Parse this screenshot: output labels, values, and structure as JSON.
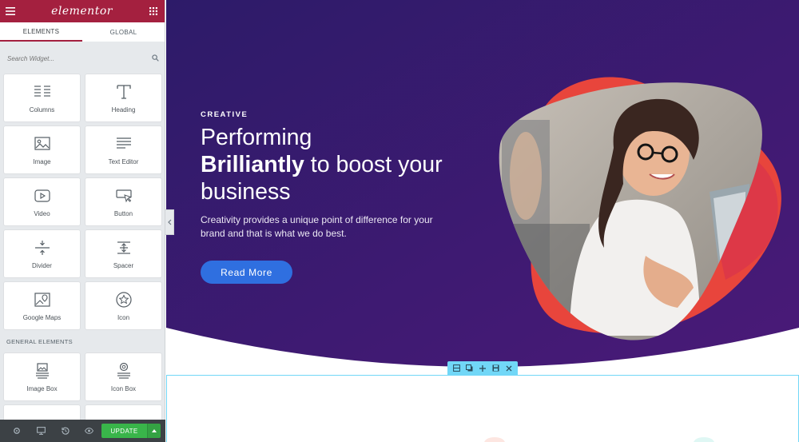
{
  "sidebar": {
    "logo": "elementor",
    "tabs": [
      {
        "label": "ELEMENTS",
        "active": true
      },
      {
        "label": "GLOBAL",
        "active": false
      }
    ],
    "search_placeholder": "Search Widget...",
    "widgets": [
      {
        "label": "Columns",
        "icon": "columns-icon"
      },
      {
        "label": "Heading",
        "icon": "heading-icon"
      },
      {
        "label": "Image",
        "icon": "image-icon"
      },
      {
        "label": "Text Editor",
        "icon": "text-editor-icon"
      },
      {
        "label": "Video",
        "icon": "video-icon"
      },
      {
        "label": "Button",
        "icon": "button-icon"
      },
      {
        "label": "Divider",
        "icon": "divider-icon"
      },
      {
        "label": "Spacer",
        "icon": "spacer-icon"
      },
      {
        "label": "Google Maps",
        "icon": "google-maps-icon"
      },
      {
        "label": "Icon",
        "icon": "star-icon"
      }
    ],
    "general_section_title": "GENERAL ELEMENTS",
    "general_widgets": [
      {
        "label": "Image Box",
        "icon": "image-box-icon"
      },
      {
        "label": "Icon Box",
        "icon": "icon-box-icon"
      }
    ],
    "footer": {
      "update_label": "UPDATE"
    }
  },
  "hero": {
    "eyebrow": "CREATIVE",
    "headline_line1": "Performing",
    "headline_bold": "Brilliantly",
    "headline_rest": " to boost your",
    "headline_line3": "business",
    "description": "Creativity provides a unique point of difference for your brand and that is what we do best.",
    "cta_label": "Read More"
  },
  "colors": {
    "brand": "#a4203f",
    "hero_gradient_start": "#2d1b69",
    "hero_gradient_end": "#4a1a78",
    "accent_shape": "#e8453c",
    "cta": "#2f6fe0",
    "update_button": "#39b54a",
    "section_outline": "#71d7f7"
  }
}
